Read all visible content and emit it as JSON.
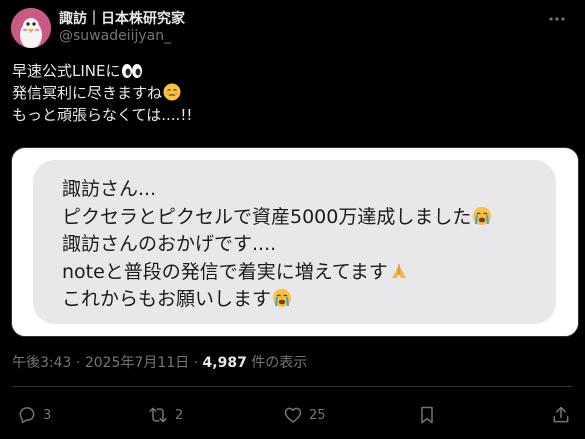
{
  "post": {
    "author": {
      "display_name": "諏訪｜日本株研究家",
      "handle": "@suwadeiijyan_",
      "avatar_icon": "penguin-avatar-icon"
    },
    "text_lines": [
      "早速公式LINEに",
      "発信冥利に尽きますね",
      "もっと頑張らなくては....!!"
    ],
    "emojis": [
      "eyes-emoji",
      "relieved-face-emoji"
    ],
    "media": {
      "type": "chat-bubble-image",
      "lines": [
        "諏訪さん...",
        "ピクセラとピクセルで資産5000万達成しました",
        "諏訪さんのおかげです....",
        "noteと普段の発信で着実に増えてます",
        "これからもお願いします"
      ],
      "emojis": [
        "loudly-crying-emoji",
        "folded-hands-emoji",
        "loudly-crying-emoji"
      ]
    },
    "meta": {
      "time": "午後3:43",
      "separator": "·",
      "date": "2025年7月11日",
      "views": "4,987",
      "views_label": "件の表示"
    },
    "actions": {
      "replies": "3",
      "reposts": "2",
      "likes": "25"
    }
  },
  "colors": {
    "background": "#000000",
    "text": "#e7e9ea",
    "muted": "#71767b",
    "bubble": "#e8e8ea"
  }
}
